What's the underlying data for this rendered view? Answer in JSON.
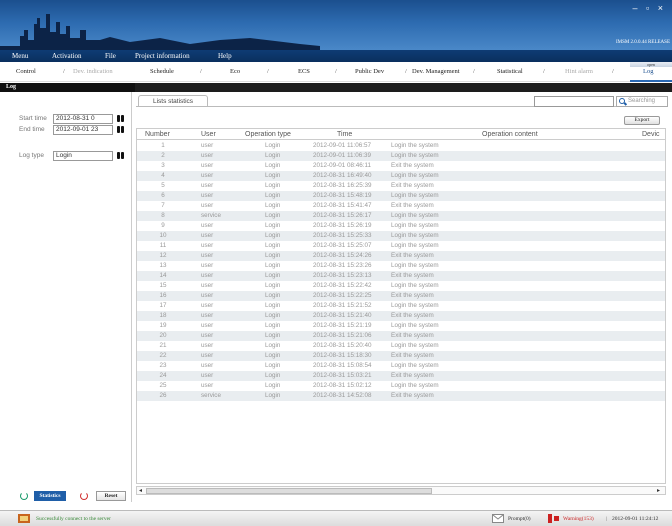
{
  "window": {
    "controls": "– ▫ ×",
    "version": "IMSM 2.0.0.44 RELEASE"
  },
  "menu": [
    {
      "label": "Menu"
    },
    {
      "label": "Activation"
    },
    {
      "label": "File"
    },
    {
      "label": "Project information"
    },
    {
      "label": "Help"
    }
  ],
  "tabs": [
    {
      "label": "Control"
    },
    {
      "label": "Dev. indication"
    },
    {
      "label": "Schedule"
    },
    {
      "label": "Eco"
    },
    {
      "label": "ECS"
    },
    {
      "label": "Public Dev"
    },
    {
      "label": "Dev. Management"
    },
    {
      "label": "Statistical"
    },
    {
      "label": "Hint alarm"
    },
    {
      "label": "Log"
    }
  ],
  "tab_indicator": "open",
  "page_title": "Log",
  "filters": {
    "start_label": "Start time",
    "start_value": "2012-08-31 0",
    "end_label": "End time",
    "end_value": "2012-09-01 23",
    "type_label": "Log type",
    "type_value": "Login"
  },
  "buttons": {
    "statistics": "Statistics",
    "reset": "Reset",
    "export": "Export",
    "search": "Searching"
  },
  "list_tab": "Lists statistics",
  "columns": {
    "number": "Number",
    "user": "User",
    "operation_type": "Operation type",
    "time": "Time",
    "operation_content": "Operation content",
    "device": "Devic"
  },
  "rows": [
    {
      "n": "1",
      "user": "user",
      "type": "Login",
      "time": "2012-09-01 11:06:57",
      "content": "Login the system"
    },
    {
      "n": "2",
      "user": "user",
      "type": "Login",
      "time": "2012-09-01 11:06:39",
      "content": "Login the system"
    },
    {
      "n": "3",
      "user": "user",
      "type": "Login",
      "time": "2012-09-01 08:46:11",
      "content": "Exit the system"
    },
    {
      "n": "4",
      "user": "user",
      "type": "Login",
      "time": "2012-08-31 16:49:40",
      "content": "Login the system"
    },
    {
      "n": "5",
      "user": "user",
      "type": "Login",
      "time": "2012-08-31 16:25:39",
      "content": "Exit the system"
    },
    {
      "n": "6",
      "user": "user",
      "type": "Login",
      "time": "2012-08-31 15:48:19",
      "content": "Login the system"
    },
    {
      "n": "7",
      "user": "user",
      "type": "Login",
      "time": "2012-08-31 15:41:47",
      "content": "Exit the system"
    },
    {
      "n": "8",
      "user": "service",
      "type": "Login",
      "time": "2012-08-31 15:26:17",
      "content": "Login the system"
    },
    {
      "n": "9",
      "user": "user",
      "type": "Login",
      "time": "2012-08-31 15:26:19",
      "content": "Login the system"
    },
    {
      "n": "10",
      "user": "user",
      "type": "Login",
      "time": "2012-08-31 15:25:33",
      "content": "Login the system"
    },
    {
      "n": "11",
      "user": "user",
      "type": "Login",
      "time": "2012-08-31 15:25:07",
      "content": "Login the system"
    },
    {
      "n": "12",
      "user": "user",
      "type": "Login",
      "time": "2012-08-31 15:24:26",
      "content": "Exit the system"
    },
    {
      "n": "13",
      "user": "user",
      "type": "Login",
      "time": "2012-08-31 15:23:26",
      "content": "Login the system"
    },
    {
      "n": "14",
      "user": "user",
      "type": "Login",
      "time": "2012-08-31 15:23:13",
      "content": "Exit the system"
    },
    {
      "n": "15",
      "user": "user",
      "type": "Login",
      "time": "2012-08-31 15:22:42",
      "content": "Login the system"
    },
    {
      "n": "16",
      "user": "user",
      "type": "Login",
      "time": "2012-08-31 15:22:25",
      "content": "Exit the system"
    },
    {
      "n": "17",
      "user": "user",
      "type": "Login",
      "time": "2012-08-31 15:21:52",
      "content": "Login the system"
    },
    {
      "n": "18",
      "user": "user",
      "type": "Login",
      "time": "2012-08-31 15:21:40",
      "content": "Exit the system"
    },
    {
      "n": "19",
      "user": "user",
      "type": "Login",
      "time": "2012-08-31 15:21:19",
      "content": "Login the system"
    },
    {
      "n": "20",
      "user": "user",
      "type": "Login",
      "time": "2012-08-31 15:21:06",
      "content": "Exit the system"
    },
    {
      "n": "21",
      "user": "user",
      "type": "Login",
      "time": "2012-08-31 15:20:40",
      "content": "Login the system"
    },
    {
      "n": "22",
      "user": "user",
      "type": "Login",
      "time": "2012-08-31 15:18:30",
      "content": "Exit the system"
    },
    {
      "n": "23",
      "user": "user",
      "type": "Login",
      "time": "2012-08-31 15:08:54",
      "content": "Login the system"
    },
    {
      "n": "24",
      "user": "user",
      "type": "Login",
      "time": "2012-08-31 15:03:21",
      "content": "Exit the system"
    },
    {
      "n": "25",
      "user": "user",
      "type": "Login",
      "time": "2012-08-31 15:02:12",
      "content": "Login the system"
    },
    {
      "n": "26",
      "user": "service",
      "type": "Login",
      "time": "2012-08-31 14:52:08",
      "content": "Exit the system"
    }
  ],
  "status": {
    "connection": "Successfully connect to the server",
    "prompt": "Prompt(0)",
    "warning": "Warning(153)",
    "datetime": "2012-09-01 11:24:12"
  },
  "colors": {
    "brand_blue": "#1f5ea8",
    "banner": "#2d6bb0",
    "row_alt": "#e9edf0",
    "warning": "#cc2222"
  }
}
